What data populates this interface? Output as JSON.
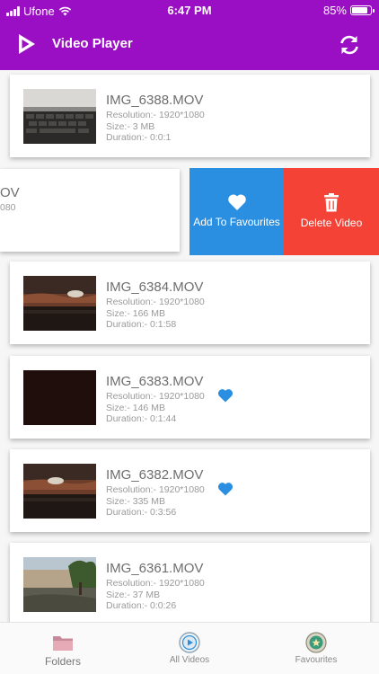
{
  "status_bar": {
    "carrier": "Ufone",
    "time": "6:47 PM",
    "battery": "85%"
  },
  "app_bar": {
    "title": "Video Player",
    "logo_icon": "play-triangle-icon",
    "refresh_icon": "refresh-icon"
  },
  "swiped_item": {
    "name_fragment": "OV",
    "resolution_fragment": "080",
    "actions": {
      "favourite_label": "Add To Favourites",
      "delete_label": "Delete Video"
    }
  },
  "videos": [
    {
      "name": "IMG_6388.MOV",
      "resolution": "Resolution:- 1920*1080",
      "size": "Size:- 3 MB",
      "duration": "Duration:- 0:0:1",
      "favourite": false
    },
    {
      "name": "IMG_6384.MOV",
      "resolution": "Resolution:- 1920*1080",
      "size": "Size:- 166 MB",
      "duration": "Duration:- 0:1:58",
      "favourite": false
    },
    {
      "name": "IMG_6383.MOV",
      "resolution": "Resolution:- 1920*1080",
      "size": "Size:- 146 MB",
      "duration": "Duration:- 0:1:44",
      "favourite": true
    },
    {
      "name": "IMG_6382.MOV",
      "resolution": "Resolution:- 1920*1080",
      "size": "Size:- 335 MB",
      "duration": "Duration:- 0:3:56",
      "favourite": true
    },
    {
      "name": "IMG_6361.MOV",
      "resolution": "Resolution:- 1920*1080",
      "size": "Size:- 37 MB",
      "duration": "Duration:- 0:0:26",
      "favourite": false
    }
  ],
  "tab_bar": {
    "tabs": [
      {
        "label": "Folders",
        "icon": "folder-icon"
      },
      {
        "label": "All Videos",
        "icon": "play-circle-icon"
      },
      {
        "label": "Favourites",
        "icon": "favourites-badge-icon"
      }
    ]
  },
  "colors": {
    "header": "#9b0fc4",
    "favourite_action": "#2a8fe0",
    "delete_action": "#f44336",
    "heart": "#2a8fe0"
  }
}
